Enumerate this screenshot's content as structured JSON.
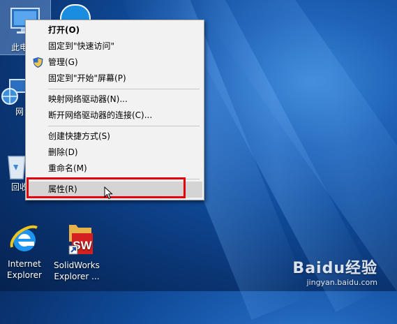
{
  "desktop": {
    "icons": [
      {
        "label": "此电脑",
        "visible": "此电"
      },
      {
        "label": "网络",
        "visible": "网"
      },
      {
        "label": "回收站",
        "visible": "回收"
      },
      {
        "label": "Internet Explorer",
        "line1": "Internet",
        "line2": "Explorer"
      },
      {
        "label": "SolidWorks Explorer ...",
        "line1": "SolidWorks",
        "line2": "Explorer ..."
      }
    ]
  },
  "context_menu": {
    "items": [
      {
        "label": "打开(O)",
        "bold": true
      },
      {
        "label": "固定到\"快速访问\""
      },
      {
        "label": "管理(G)",
        "icon": "shield-icon"
      },
      {
        "label": "固定到\"开始\"屏幕(P)"
      },
      {
        "label": "映射网络驱动器(N)..."
      },
      {
        "label": "断开网络驱动器的连接(C)..."
      },
      {
        "label": "创建快捷方式(S)"
      },
      {
        "label": "删除(D)"
      },
      {
        "label": "重命名(M)"
      },
      {
        "label": "属性(R)",
        "highlighted": true
      }
    ]
  },
  "watermark": {
    "logo": "Baidu经验",
    "url": "jingyan.baidu.com"
  },
  "colors": {
    "highlight_box": "#e3000b",
    "menu_bg": "#f2f2f2"
  }
}
